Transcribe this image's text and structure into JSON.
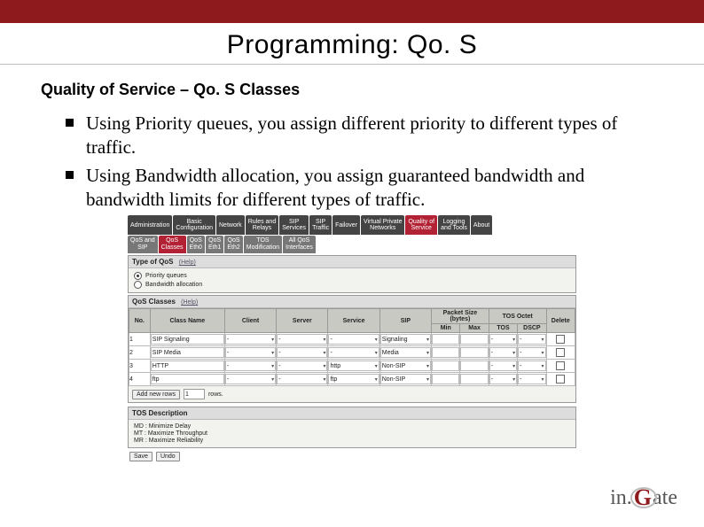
{
  "slide": {
    "title": "Programming: Qo. S",
    "subtitle": "Quality of Service – Qo. S Classes",
    "bullets": [
      "Using Priority queues, you assign different priority to different types of traffic.",
      "Using Bandwidth allocation, you assign guaranteed bandwidth and bandwidth limits for different types of traffic."
    ]
  },
  "ui": {
    "main_tabs": [
      "Administration",
      "Basic\nConfiguration",
      "Network",
      "Rules and\nRelays",
      "SIP\nServices",
      "SIP\nTraffic",
      "Failover",
      "Virtual Private\nNetworks",
      "Quality of\nService",
      "Logging\nand Tools",
      "About"
    ],
    "main_tabs_active_index": 8,
    "sub_tabs": [
      "QoS and\nSIP",
      "QoS\nClasses",
      "QoS\nEth0",
      "QoS\nEth1",
      "QoS\nEth2",
      "TOS\nModification",
      "All QoS\nInterfaces"
    ],
    "sub_tabs_active_index": 1,
    "type_section": {
      "title": "Type of QoS",
      "help": "(Help)",
      "options": [
        "Priority queues",
        "Bandwidth allocation"
      ],
      "selected_index": 0
    },
    "classes_section": {
      "title": "QoS Classes",
      "help": "(Help)",
      "header_row1": [
        "No.",
        "Class Name",
        "Client",
        "Server",
        "Service",
        "SIP",
        "Packet Size (bytes)",
        "TOS Octet",
        "Delete"
      ],
      "header_row2_packet": [
        "Min",
        "Max"
      ],
      "header_row2_tos": [
        "TOS",
        "DSCP"
      ],
      "rows": [
        {
          "no": "1",
          "class": "SIP Signaling",
          "client": "-",
          "server": "-",
          "service": "-",
          "sip": "Signaling",
          "min": "",
          "max": "",
          "tos": "-",
          "dscp": "-"
        },
        {
          "no": "2",
          "class": "SIP Media",
          "client": "-",
          "server": "-",
          "service": "-",
          "sip": "Media",
          "min": "",
          "max": "",
          "tos": "-",
          "dscp": "-"
        },
        {
          "no": "3",
          "class": "HTTP",
          "client": "-",
          "server": "-",
          "service": "http",
          "sip": "Non-SIP",
          "min": "",
          "max": "",
          "tos": "-",
          "dscp": "-"
        },
        {
          "no": "4",
          "class": "ftp",
          "client": "-",
          "server": "-",
          "service": "ftp",
          "sip": "Non-SIP",
          "min": "",
          "max": "",
          "tos": "-",
          "dscp": "-"
        }
      ],
      "add_label": "Add new rows",
      "add_count": "1",
      "add_suffix": "rows."
    },
    "tos_section": {
      "title": "TOS Description",
      "rows": [
        "MD : Minimize Delay",
        "MT : Maximize Throughput",
        "MR : Maximize Reliability"
      ]
    },
    "footer": {
      "save": "Save",
      "undo": "Undo"
    }
  },
  "logo": {
    "in": "in.",
    "g": "G",
    "ate": "ate"
  }
}
